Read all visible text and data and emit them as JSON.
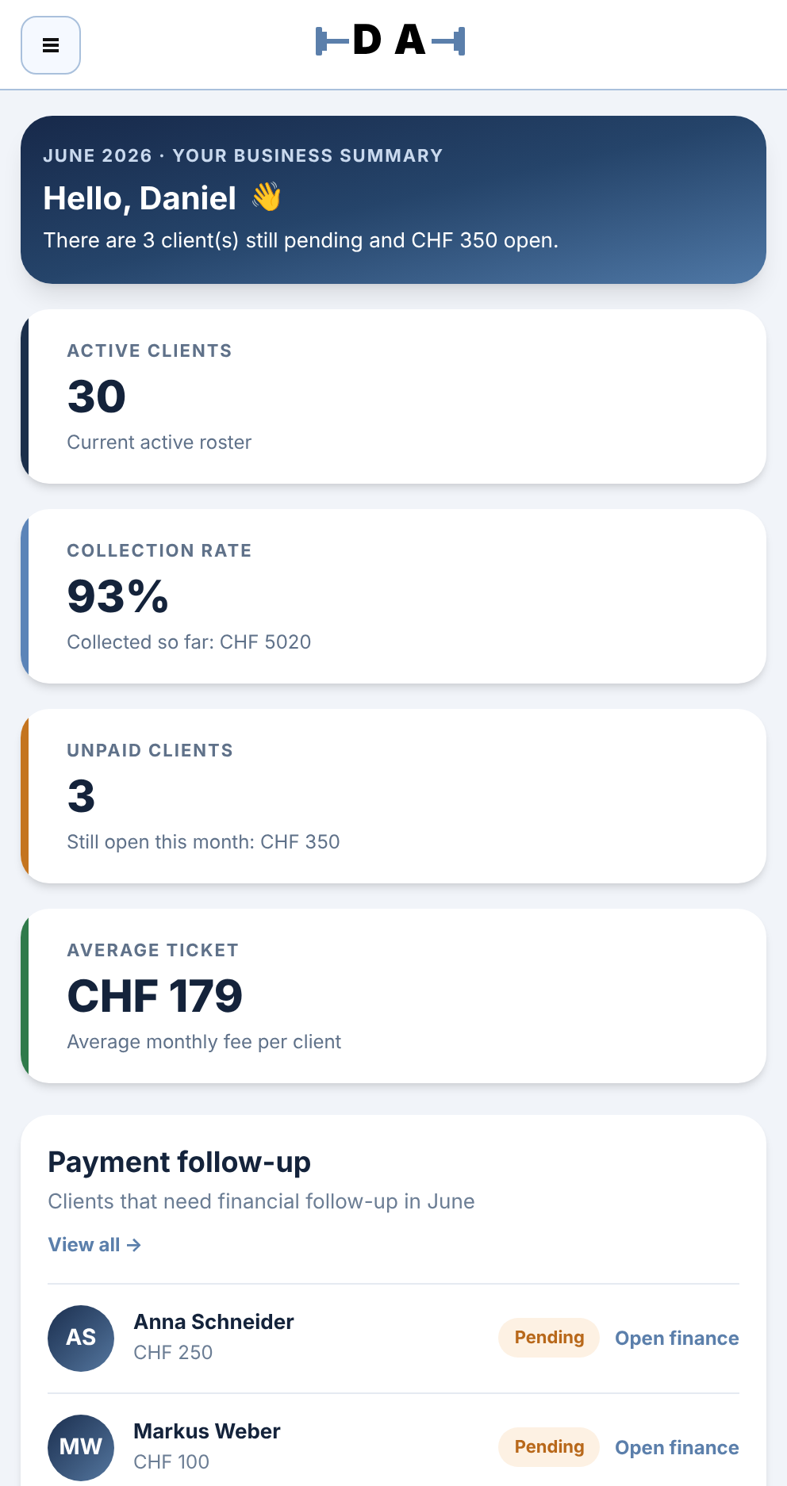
{
  "header": {
    "logo": "D A"
  },
  "summary": {
    "eyebrow": "JUNE 2026 · YOUR BUSINESS SUMMARY",
    "greeting": "Hello, Daniel",
    "emoji": "👋",
    "text": "There are 3 client(s) still pending and CHF 350 open."
  },
  "stats": [
    {
      "label": "ACTIVE CLIENTS",
      "value": "30",
      "note": "Current active roster",
      "color": "#1b2f4b"
    },
    {
      "label": "COLLECTION RATE",
      "value": "93%",
      "note": "Collected so far: CHF 5020",
      "color": "#5b84b8"
    },
    {
      "label": "UNPAID CLIENTS",
      "value": "3",
      "note": "Still open this month: CHF 350",
      "color": "#c4741f"
    },
    {
      "label": "AVERAGE TICKET",
      "value": "CHF 179",
      "note": "Average monthly fee per client",
      "color": "#2f7a4a"
    }
  ],
  "followup": {
    "title": "Payment follow-up",
    "subtitle": "Clients that need financial follow-up in June",
    "view_all": "View all →",
    "rows": [
      {
        "initials": "AS",
        "name": "Anna Schneider",
        "amount": "CHF 250",
        "status": "Pending",
        "action": "Open finance"
      },
      {
        "initials": "MW",
        "name": "Markus Weber",
        "amount": "CHF 100",
        "status": "Pending",
        "action": "Open finance"
      }
    ]
  }
}
